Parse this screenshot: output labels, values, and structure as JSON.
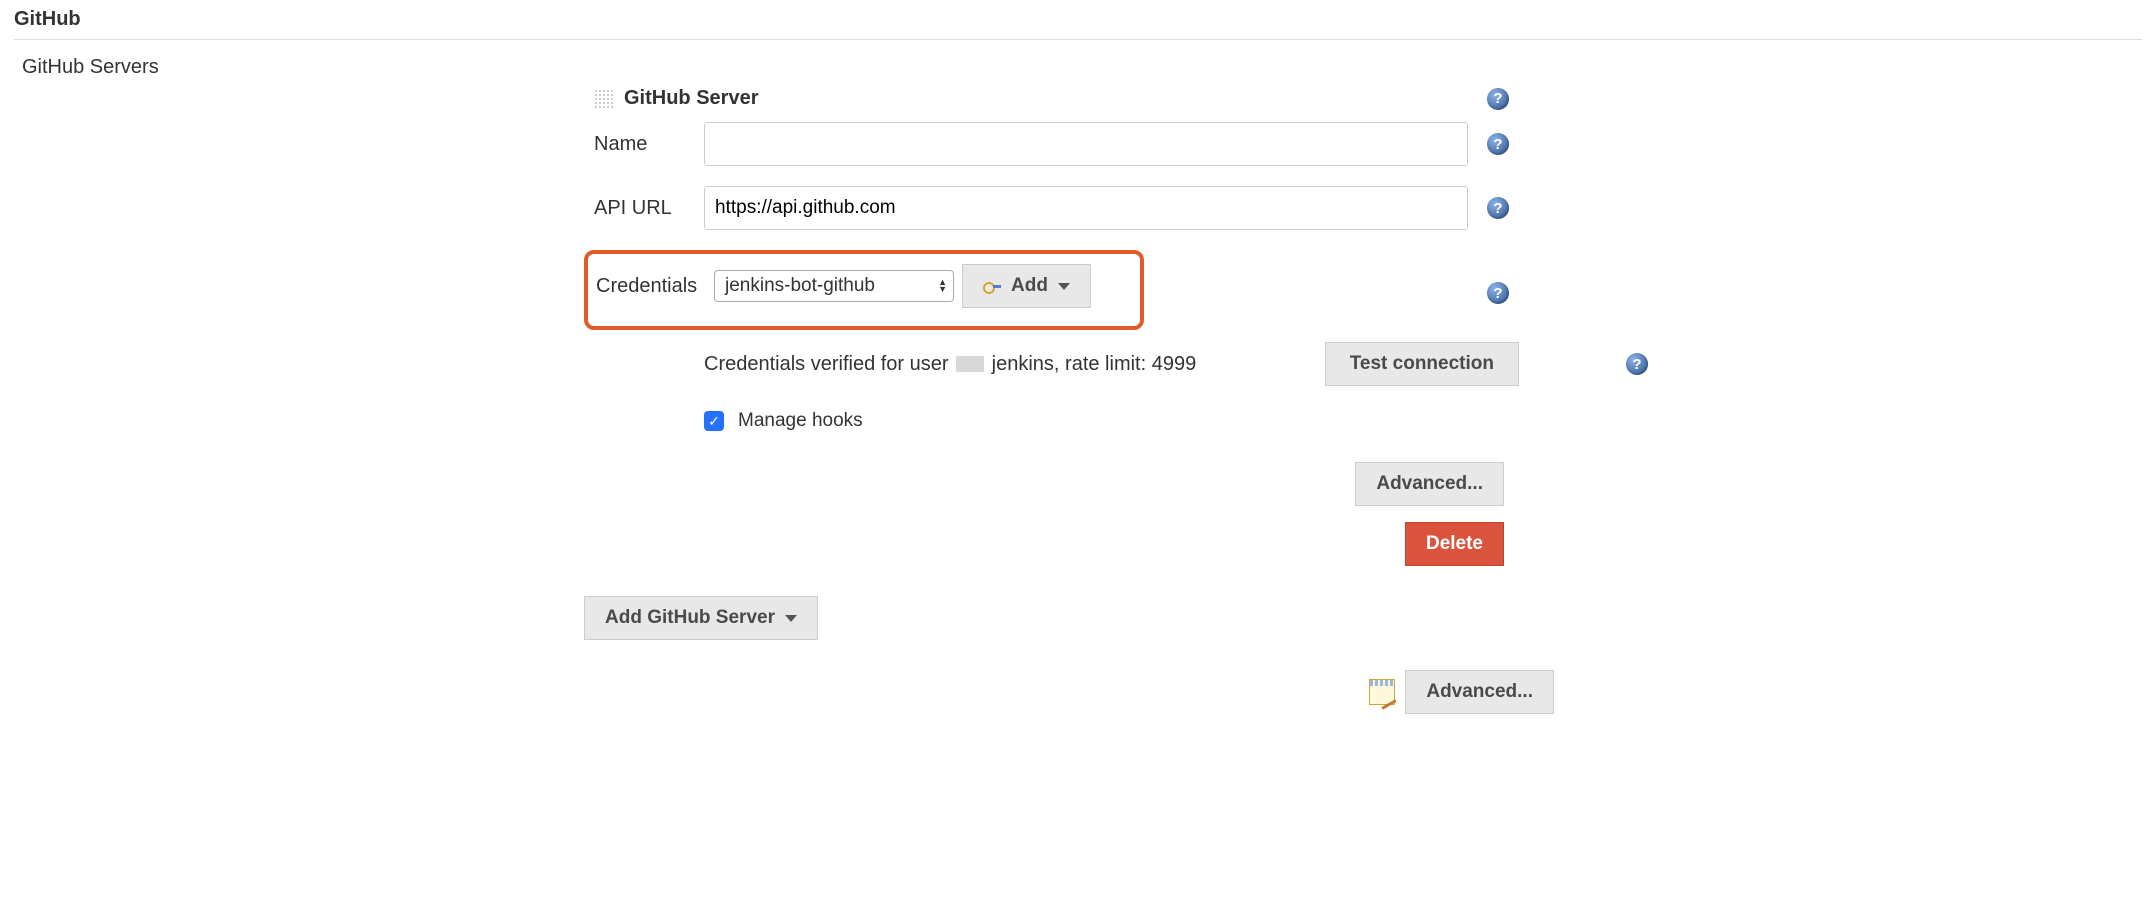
{
  "section": {
    "title": "GitHub",
    "servers_label": "GitHub Servers"
  },
  "server": {
    "header": "GitHub Server",
    "fields": {
      "name_label": "Name",
      "name_value": "",
      "api_url_label": "API URL",
      "api_url_value": "https://api.github.com",
      "credentials_label": "Credentials",
      "credentials_selected": "jenkins-bot-github"
    },
    "add_button": "Add",
    "status_prefix": "Credentials verified for user ",
    "status_suffix": "jenkins, rate limit: 4999",
    "test_connection": "Test connection",
    "manage_hooks_label": "Manage hooks",
    "advanced_button": "Advanced...",
    "delete_button": "Delete"
  },
  "footer": {
    "add_server": "Add GitHub Server",
    "advanced": "Advanced..."
  }
}
